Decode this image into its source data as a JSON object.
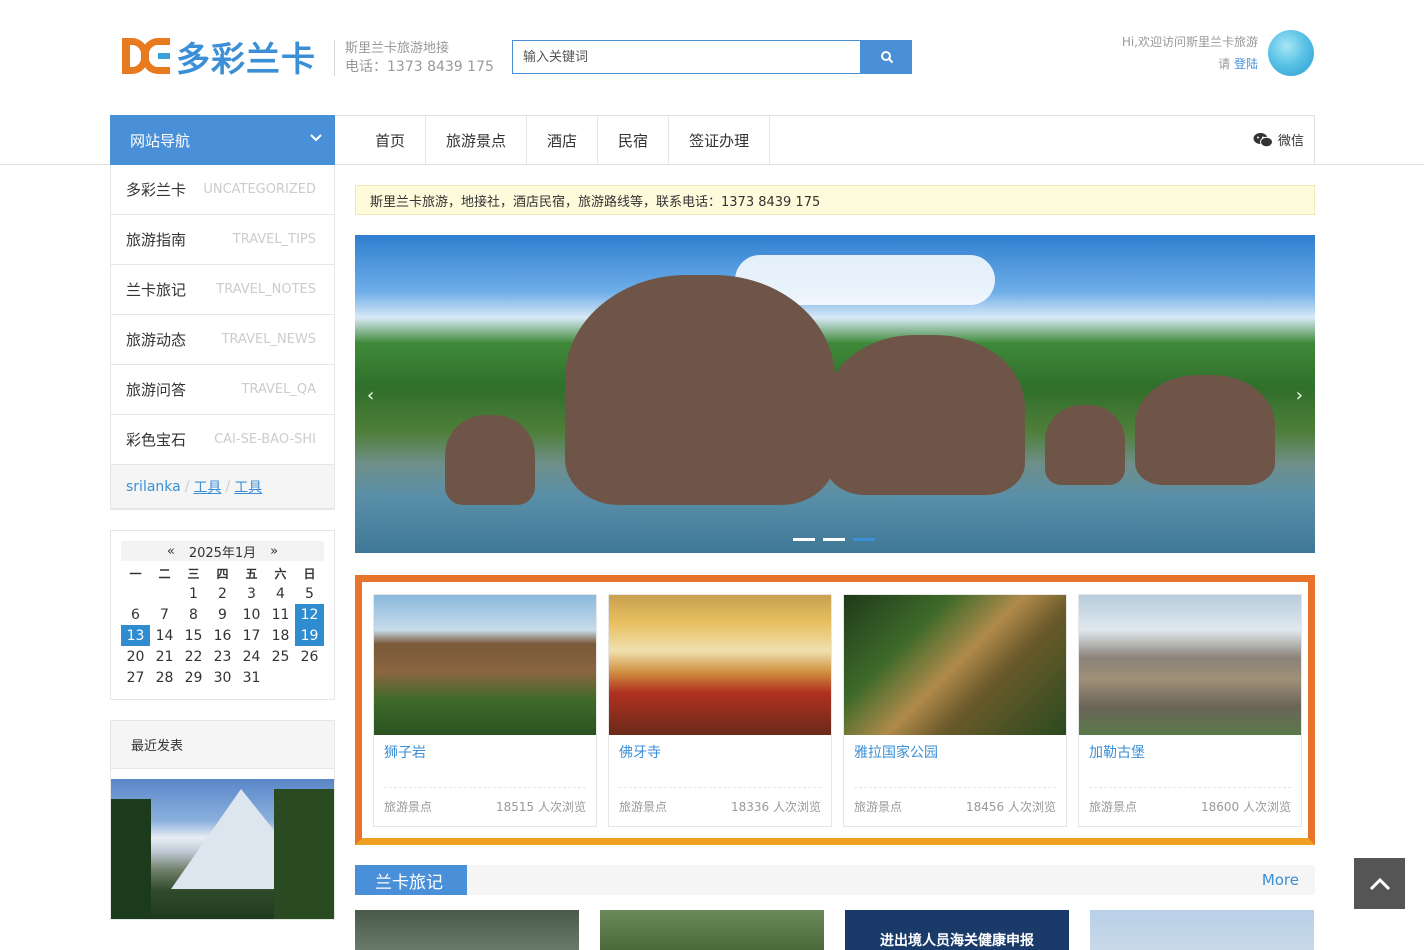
{
  "header": {
    "logo_text": "多彩兰卡",
    "desc_line1": "斯里兰卡旅游地接",
    "desc_line2": "电话：1373 8439 175",
    "search_placeholder": "输入关键词",
    "greeting": "Hi,欢迎访问斯里兰卡旅游",
    "login_prefix": "请",
    "login_link": "登陆"
  },
  "nav": {
    "site_nav": "网站导航",
    "items": [
      "首页",
      "旅游景点",
      "酒店",
      "民宿",
      "签证办理"
    ],
    "wechat": "微信"
  },
  "sidebar": {
    "categories": [
      {
        "cn": "多彩兰卡",
        "en": "UNCATEGORIZED"
      },
      {
        "cn": "旅游指南",
        "en": "TRAVEL_TIPS"
      },
      {
        "cn": "兰卡旅记",
        "en": "TRAVEL_NOTES"
      },
      {
        "cn": "旅游动态",
        "en": "TRAVEL_NEWS"
      },
      {
        "cn": "旅游问答",
        "en": "TRAVEL_QA"
      },
      {
        "cn": "彩色宝石",
        "en": "CAI-SE-BAO-SHI"
      }
    ],
    "tags": [
      "srilanka",
      "工具",
      "工具"
    ],
    "calendar": {
      "prev": "«",
      "month": "2025年1月",
      "next": "»",
      "weekdays": [
        "一",
        "二",
        "三",
        "四",
        "五",
        "六",
        "日"
      ],
      "weeks": [
        [
          "",
          "",
          "1",
          "2",
          "3",
          "4",
          "5"
        ],
        [
          "6",
          "7",
          "8",
          "9",
          "10",
          "11",
          "12"
        ],
        [
          "13",
          "14",
          "15",
          "16",
          "17",
          "18",
          "19"
        ],
        [
          "20",
          "21",
          "22",
          "23",
          "24",
          "25",
          "26"
        ],
        [
          "27",
          "28",
          "29",
          "30",
          "31",
          "",
          ""
        ]
      ],
      "highlighted": [
        "12",
        "13",
        "19"
      ]
    },
    "recent_title": "最近发表"
  },
  "main": {
    "notice": "斯里兰卡旅游，地接社，酒店民宿，旅游路线等，联系电话：1373 8439 175",
    "banner": {
      "prev": "‹",
      "next": "›"
    },
    "featured": [
      {
        "title": "狮子岩",
        "category": "旅游景点",
        "views": "18515 人次浏览"
      },
      {
        "title": "佛牙寺",
        "category": "旅游景点",
        "views": "18336 人次浏览"
      },
      {
        "title": "雅拉国家公园",
        "category": "旅游景点",
        "views": "18456 人次浏览"
      },
      {
        "title": "加勒古堡",
        "category": "旅游景点",
        "views": "18600 人次浏览"
      }
    ],
    "section_title": "兰卡旅记",
    "section_more": "More",
    "thumb3_text": "进出境人员海关健康申报"
  },
  "colors": {
    "brand_blue": "#4a90d9",
    "brand_orange": "#e8732a"
  }
}
